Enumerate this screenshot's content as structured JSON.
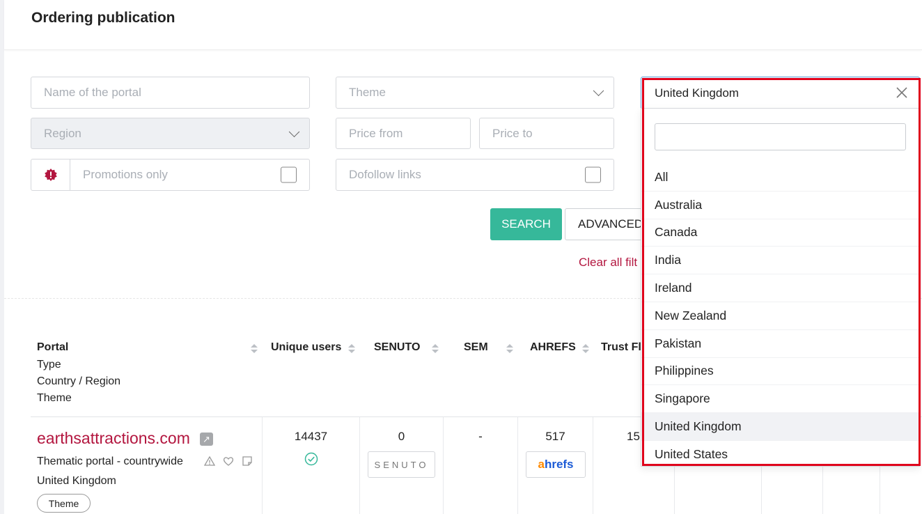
{
  "page": {
    "title": "Ordering publication"
  },
  "filters": {
    "portal_name_placeholder": "Name of the portal",
    "theme_placeholder": "Theme",
    "region_placeholder": "Region",
    "price_from_placeholder": "Price from",
    "price_to_placeholder": "Price to",
    "promotions_label": "Promotions only",
    "dofollow_label": "Dofollow links",
    "country_selected": "United Kingdom",
    "search_button": "SEARCH",
    "advanced_button": "ADVANCED",
    "clear_link": "Clear all filt"
  },
  "country_dropdown": {
    "options": [
      "All",
      "Australia",
      "Canada",
      "India",
      "Ireland",
      "New Zealand",
      "Pakistan",
      "Philippines",
      "Singapore",
      "United Kingdom",
      "United States"
    ],
    "selected_index": 9
  },
  "table": {
    "portal_header": [
      "Portal",
      "Type",
      "Country / Region",
      "Theme"
    ],
    "headers": [
      "Unique users",
      "SENUTO",
      "SEM",
      "AHREFS",
      "Trust Fl"
    ],
    "row": {
      "portal": "earthsattractions.com",
      "type": "Thematic portal - countrywide",
      "country": "United Kingdom",
      "theme_tag": "Theme",
      "unique_users": "14437",
      "senuto": "0",
      "senuto_logo": "SENUTO",
      "sem": "-",
      "ahrefs": "517",
      "ahrefs_logo_a": "a",
      "ahrefs_logo_rest": "hrefs",
      "trust_flow": "15"
    }
  },
  "colors": {
    "accent": "#36b89a",
    "brand": "#b3163f",
    "highlight": "#e0001b"
  }
}
